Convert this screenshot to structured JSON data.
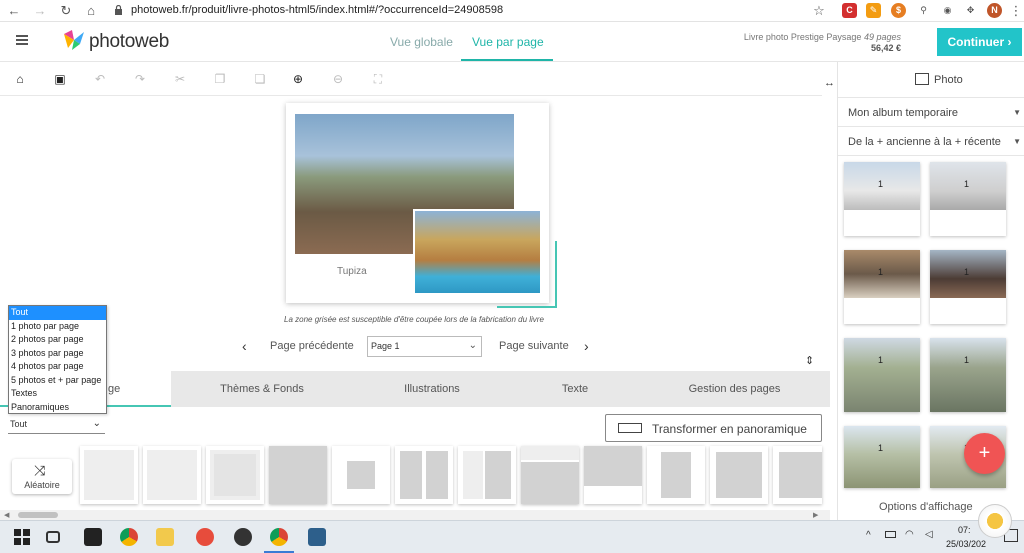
{
  "browser": {
    "url": "photoweb.fr/produit/livre-photos-html5/index.html#/?occurrenceId=24908598",
    "profile_initial": "N"
  },
  "header": {
    "logo": "photoweb",
    "tabs": [
      "Vue globale",
      "Vue par page"
    ],
    "active_tab": "Vue par page",
    "product_name": "Livre photo Prestige Paysage",
    "product_pages": "49 pages",
    "product_price": "56,42 €",
    "continue_label": "Continuer"
  },
  "right_panel": {
    "title": "Photo",
    "album_select": "Mon album temporaire",
    "sort_select": "De la + ancienne à la + récente",
    "thumb_count_label": "1",
    "options_label": "Options d'affichage"
  },
  "canvas": {
    "caption": "Tupiza",
    "disclaimer": "La zone grisée est susceptible d'être coupée lors de la fabrication du livre"
  },
  "page_nav": {
    "prev_label": "Page précédente",
    "current_page": "Page 1",
    "next_label": "Page suivante"
  },
  "bottom_tabs": [
    "ge",
    "Thèmes & Fonds",
    "Illustrations",
    "Texte",
    "Gestion des pages"
  ],
  "filter": {
    "options": [
      "Tout",
      "1 photo par page",
      "2 photos par page",
      "3 photos par page",
      "4 photos par page",
      "5 photos et + par page",
      "Textes",
      "Panoramiques"
    ],
    "selected": "Tout"
  },
  "panorama_button": "Transformer en panoramique",
  "random_button": "Aléatoire",
  "taskbar": {
    "time": "07:",
    "date": "25/03/202"
  },
  "colors": {
    "accent": "#1fb5a8",
    "continue_bg": "#22c4c9",
    "fab": "#f05454",
    "dropdown_selected": "#1e90ff"
  }
}
